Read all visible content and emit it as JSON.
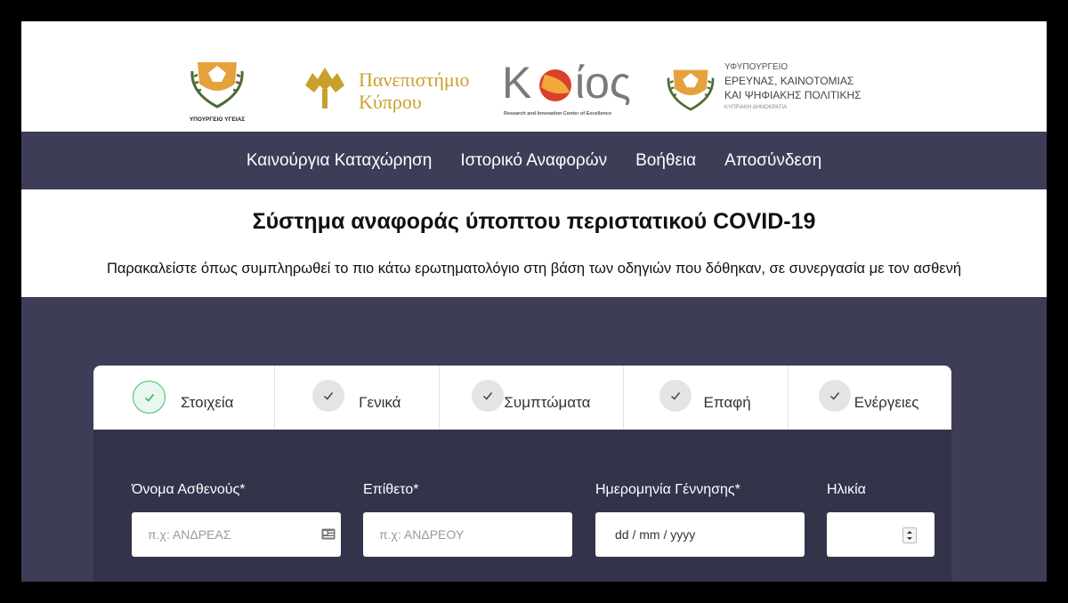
{
  "logos": {
    "ministry_health": "ΥΠΟΥΡΓΕΙΟ ΥΓΕΙΑΣ",
    "university_line1": "Πανεπιστήμιο",
    "university_line2": "Κύπρου",
    "koios_name": "Κ ΙΟΣ",
    "koios_tagline": "Research and Innovation Center of Excellence",
    "ministry_research_line1": "ΥΦΥΠΟΥΡΓΕΙΟ",
    "ministry_research_line2": "ΕΡΕΥΝΑΣ, ΚΑΙΝΟΤΟΜΙΑΣ",
    "ministry_research_line3": "ΚΑΙ ΨΗΦΙΑΚΗΣ ΠΟΛΙΤΙΚΗΣ",
    "ministry_research_line4": "ΚΥΠΡΙΑΚΗ ΔΗΜΟΚΡΑΤΙΑ"
  },
  "nav": {
    "items": [
      "Καινούργια Καταχώρηση",
      "Ιστορικό Αναφορών",
      "Βοήθεια",
      "Αποσύνδεση"
    ]
  },
  "header": {
    "title": "Σύστημα αναφοράς ύποπτου περιστατικού COVID-19",
    "subtitle": "Παρακαλείστε όπως συμπληρωθεί το πιο κάτω ερωτηματολόγιο στη βάση των οδηγιών που δόθηκαν, σε συνεργασία με τον ασθενή"
  },
  "tabs": [
    {
      "label": "Στοιχεία",
      "active": true
    },
    {
      "label": "Γενικά",
      "active": false
    },
    {
      "label": "Συμπτώματα",
      "active": false
    },
    {
      "label": "Επαφή",
      "active": false
    },
    {
      "label": "Ενέργειες",
      "active": false
    }
  ],
  "form": {
    "first_name": {
      "label": "Όνομα Ασθενούς*",
      "placeholder": "π.χ: ΑΝΔΡΕΑΣ",
      "value": ""
    },
    "last_name": {
      "label": "Επίθετο*",
      "placeholder": "π.χ: ΑΝΔΡΕΟΥ",
      "value": ""
    },
    "dob": {
      "label": "Ημερομηνία Γέννησης*",
      "placeholder": "dd / mm / yyyy"
    },
    "age": {
      "label": "Ηλικία",
      "value": ""
    }
  },
  "colors": {
    "navy": "#3d3d58",
    "card": "#33334a",
    "check_active": "#3fbf6a",
    "university_gold": "#c9a02c",
    "koios_red": "#d9412a"
  },
  "icons": {
    "check": "check-icon",
    "contact_card": "contact-card-icon",
    "spinner": "number-spinner-icon",
    "coat_of_arms": "coat-of-arms-icon",
    "university_tree": "university-tree-icon"
  }
}
